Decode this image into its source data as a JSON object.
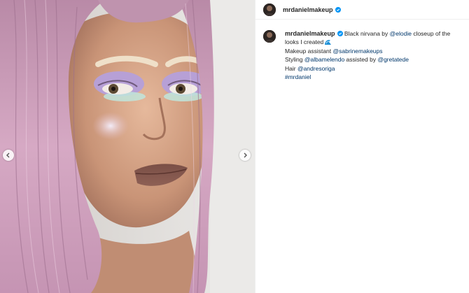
{
  "post": {
    "username": "mrdaniel­makeup",
    "verified": true,
    "media": {
      "alt_icon_prev": "chevron-left-icon",
      "alt_icon_next": "chevron-right-icon",
      "hair_color": "#c9a0bb",
      "background_color": "#e2e1df"
    },
    "caption": {
      "username": "mrdanielmakeup",
      "line1_text": " Black nirvana by ",
      "line1_mention": "@elodie",
      "line1_rest": " closeup of the looks I created",
      "emoji": "wave-emoji",
      "line2_label": "Makeup assistant ",
      "line2_mention": "@sabrinemakeups",
      "line3_label": "Styling ",
      "line3_mention1": "@albamelendo",
      "line3_mid": " assisted by ",
      "line3_mention2": "@gretatede",
      "line4_label": "Hair ",
      "line4_mention": "@andresoriga",
      "line5_hashtag": "#mrdaniel"
    },
    "colors": {
      "link": "#00376b",
      "text": "#262626",
      "verified": "#0095f6"
    }
  }
}
